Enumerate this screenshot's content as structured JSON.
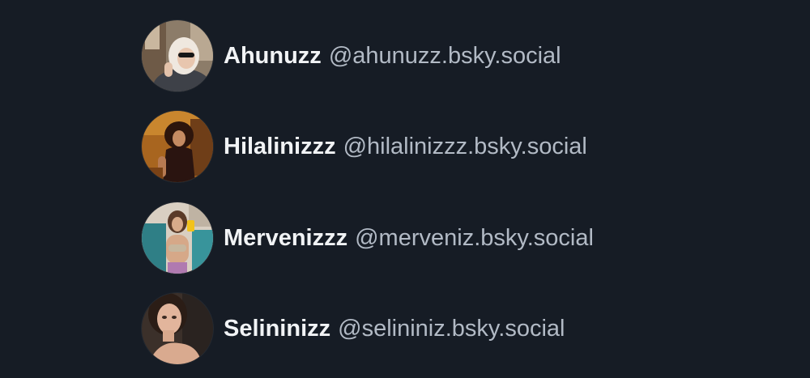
{
  "accounts": [
    {
      "display_name": "Ahunuzz",
      "handle": "@ahunuzz.bsky.social",
      "avatar_icon": "avatar-photo-blonde-woman-sunglasses",
      "avatar_colors": {
        "bg": "#8f7f6c",
        "accent": "#e8e1d8"
      }
    },
    {
      "display_name": "Hilalinizzz",
      "handle": "@hilalinizzz.bsky.social",
      "avatar_icon": "avatar-photo-woman-dark-curly-hair",
      "avatar_colors": {
        "bg": "#b8701e",
        "accent": "#3a1a0e"
      }
    },
    {
      "display_name": "Mervenizzz",
      "handle": "@merveniz.bsky.social",
      "avatar_icon": "avatar-photo-woman-mirror-selfie",
      "avatar_colors": {
        "bg": "#3b8990",
        "accent": "#d7ad8d"
      }
    },
    {
      "display_name": "Selininizz",
      "handle": "@selininiz.bsky.social",
      "avatar_icon": "avatar-photo-woman-portrait",
      "avatar_colors": {
        "bg": "#463a34",
        "accent": "#dcae95"
      }
    }
  ],
  "colors": {
    "background": "#161c25",
    "display_name": "#f1f3f5",
    "handle": "#b2bac5"
  }
}
